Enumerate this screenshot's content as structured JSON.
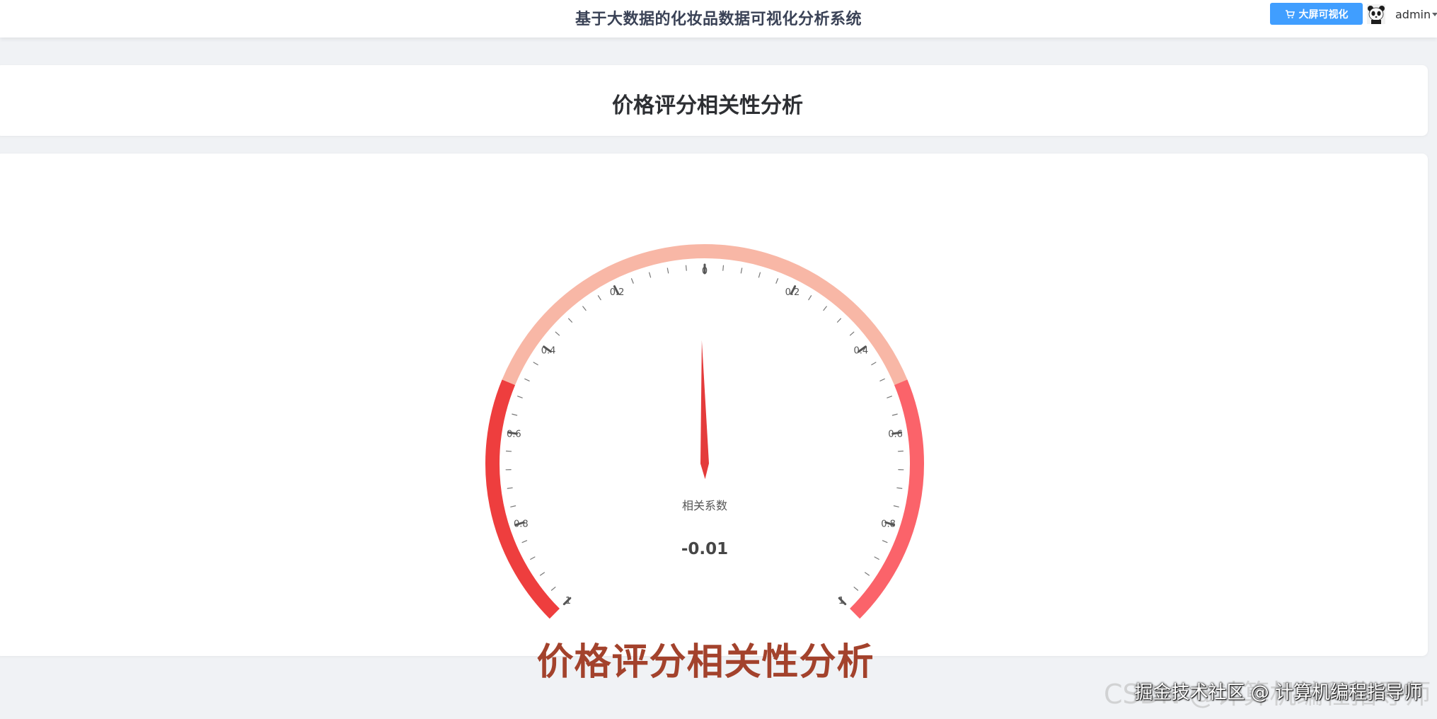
{
  "header": {
    "app_title": "基于大数据的化妆品数据可视化分析系统",
    "bigscreen_label": "大屏可视化",
    "user_name": "admin"
  },
  "page": {
    "section_title": "价格评分相关性分析"
  },
  "chart_data": {
    "type": "gauge",
    "series_name": "相关系数",
    "value": -0.01,
    "value_label": "-0.01",
    "min": -1,
    "max": 1,
    "start_angle_deg": 225,
    "end_angle_deg": -45,
    "split_number": 10,
    "minor_ticks_per_split": 5,
    "tick_labels": [
      "1",
      "0.8",
      "0.6",
      "0.4",
      "0.2",
      "0",
      "0.2",
      "0.4",
      "0.6",
      "0.8",
      "1"
    ],
    "axis_bands": [
      {
        "from": -1,
        "to": -0.5,
        "color": "#ee3e3e"
      },
      {
        "from": -0.5,
        "to": 0.5,
        "color": "#f8b7a6"
      },
      {
        "from": 0.5,
        "to": 1,
        "color": "#fb636a"
      }
    ],
    "pointer_color": "#e43b3b",
    "caption": "价格评分相关性分析"
  },
  "watermark": {
    "back_text": "CSDN @计算机编程指导师",
    "front_text": "掘金技术社区 @ 计算机编程指导师"
  }
}
